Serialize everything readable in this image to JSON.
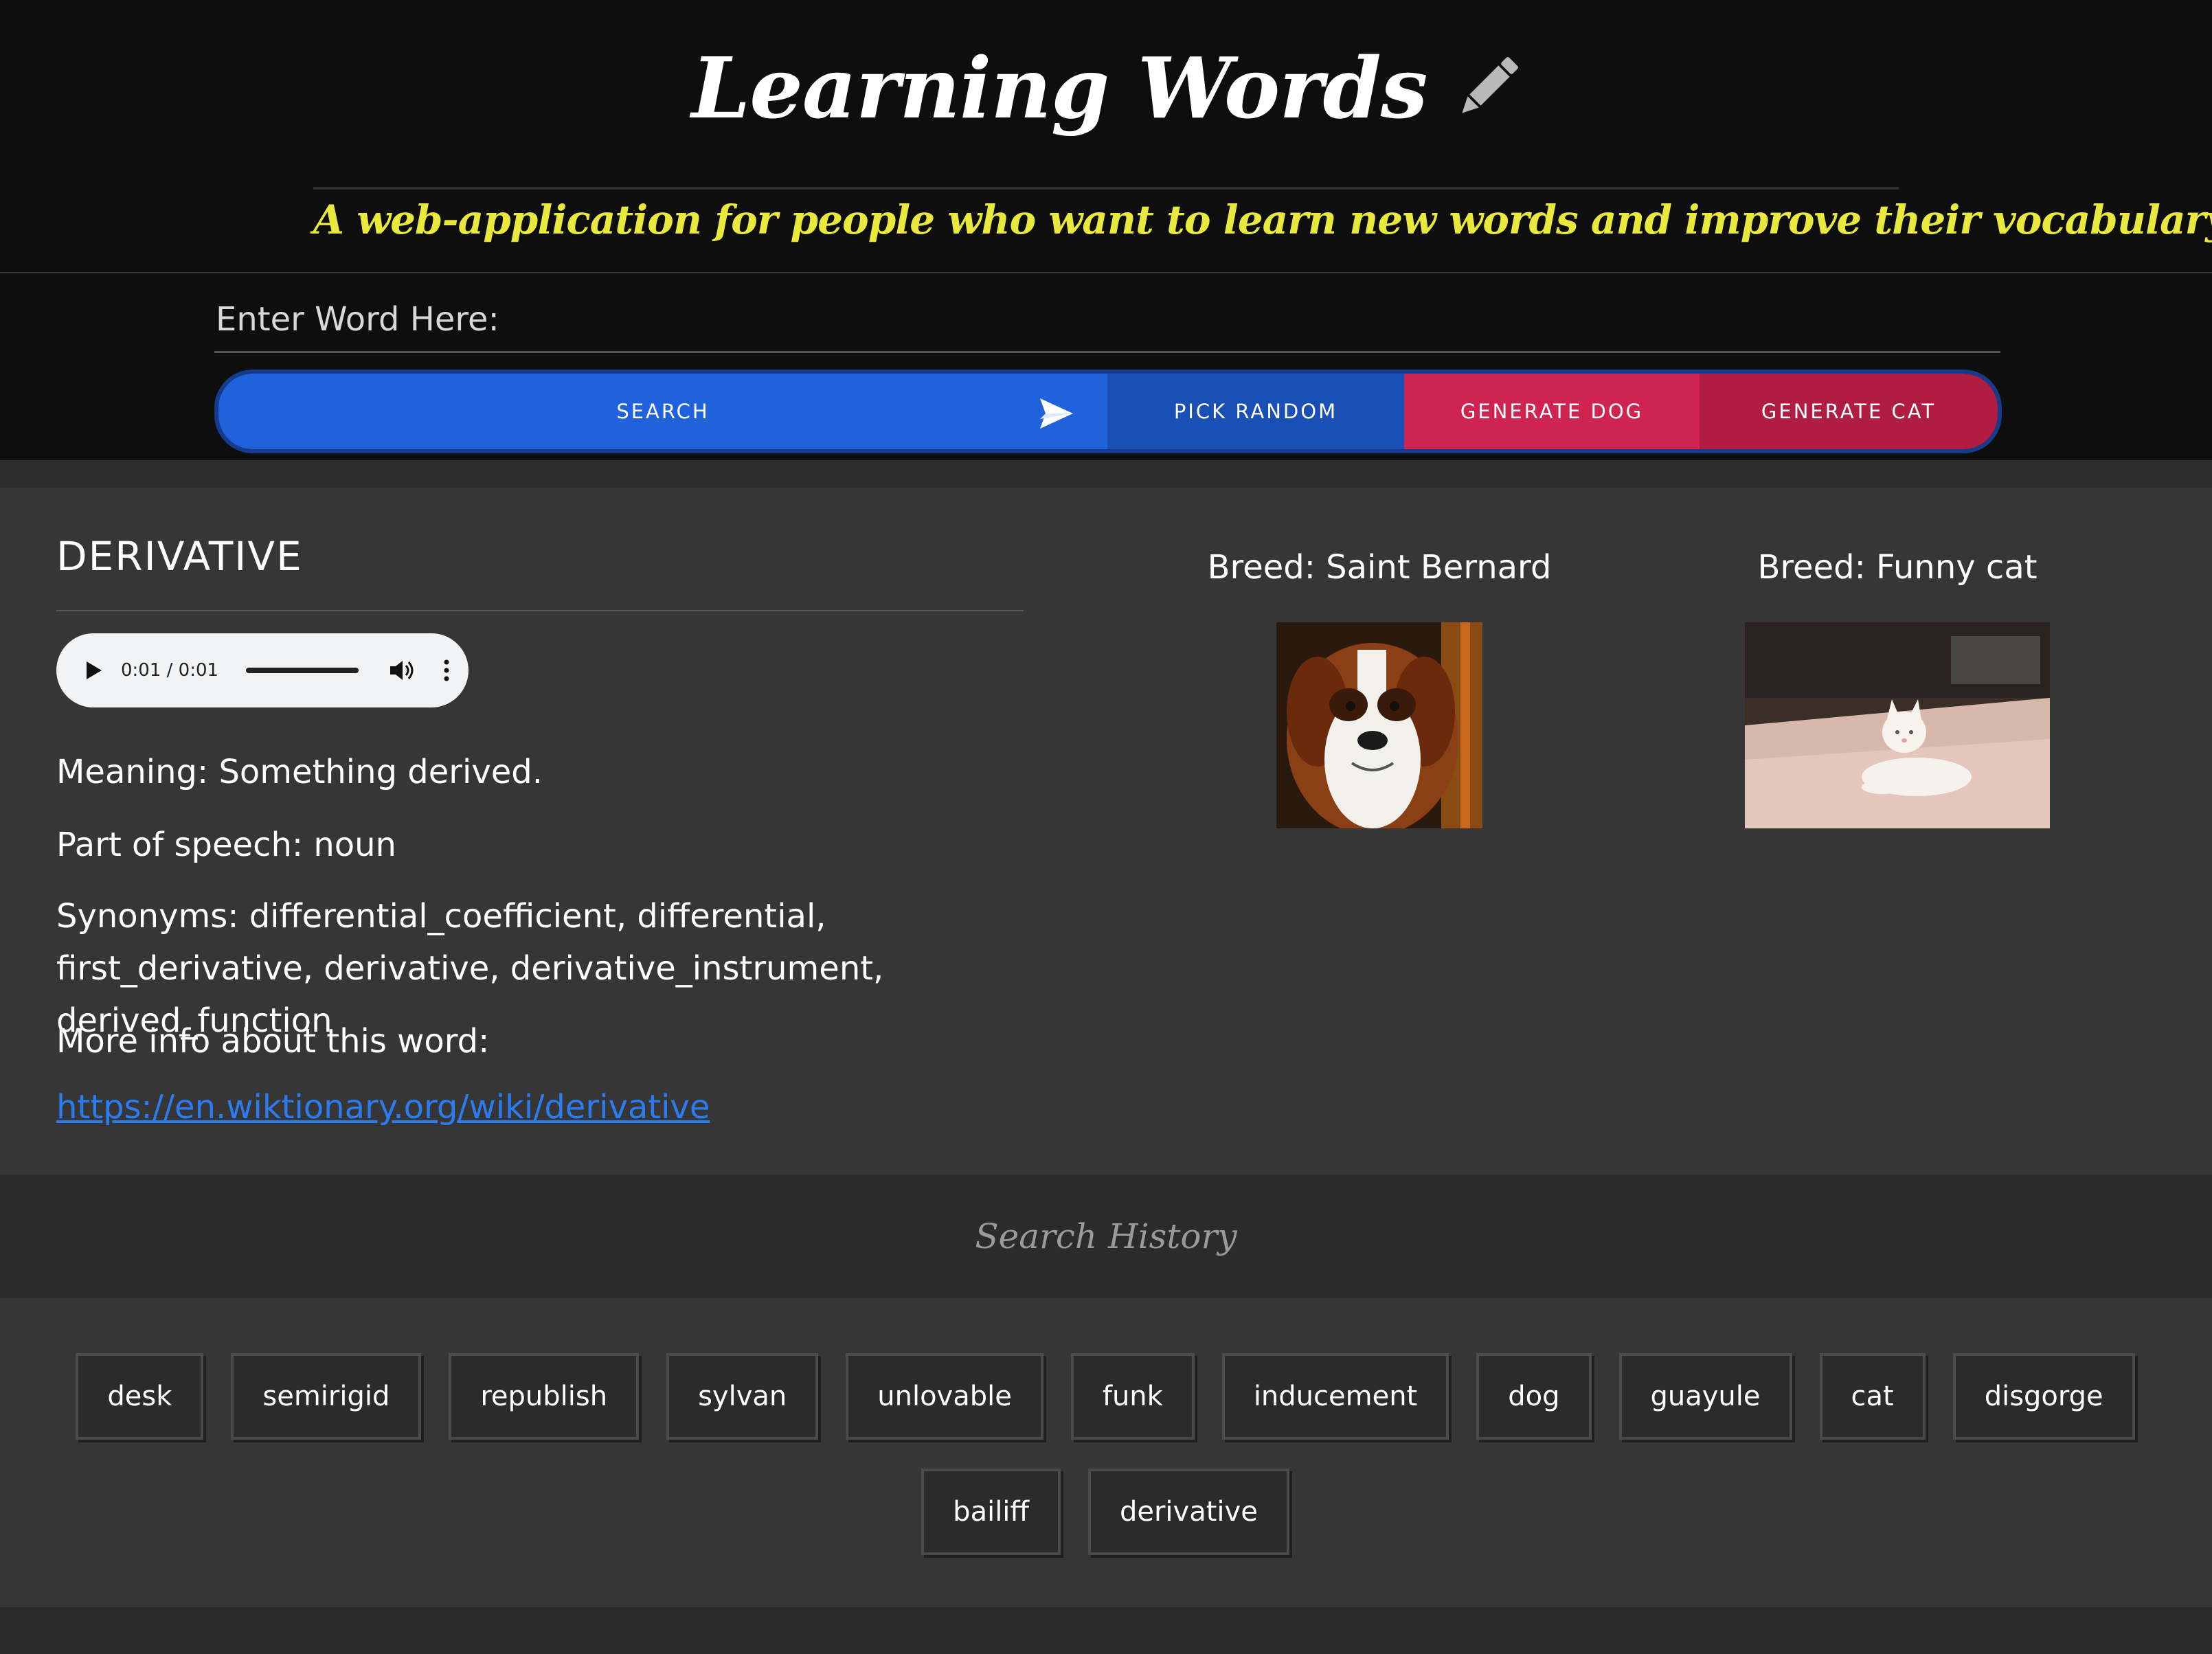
{
  "header": {
    "title": "Learning Words",
    "title_icon": "pencil-icon",
    "subtitle": "A web-application for people who want to learn new words and improve their vocabulary."
  },
  "search": {
    "placeholder": "Enter Word Here:",
    "buttons": {
      "search": "SEARCH",
      "pick_random": "PICK RANDOM",
      "generate_dog": "GENERATE DOG",
      "generate_cat": "GENERATE CAT"
    },
    "colors": {
      "search": "#1f62dc",
      "pick_random": "#1a4fb5",
      "generate_dog": "#cf2450",
      "generate_cat": "#b01c42"
    }
  },
  "word": {
    "title": "DERIVATIVE",
    "audio_time": "0:01 / 0:01",
    "meaning": "Meaning: Something derived.",
    "part_of_speech": "Part of speech: noun",
    "synonyms": "Synonyms: differential_coefficient, differential, first_derivative, derivative, derivative_instrument, derived_function",
    "more_info_label": "More info about this word:",
    "more_info_link": "https://en.wiktionary.org/wiki/derivative"
  },
  "pets": {
    "dog_breed": "Breed: Saint Bernard",
    "cat_breed": "Breed: Funny cat"
  },
  "history": {
    "title": "Search History",
    "items": [
      "desk",
      "semirigid",
      "republish",
      "sylvan",
      "unlovable",
      "funk",
      "inducement",
      "dog",
      "guayule",
      "cat",
      "disgorge",
      "bailiff",
      "derivative"
    ]
  }
}
